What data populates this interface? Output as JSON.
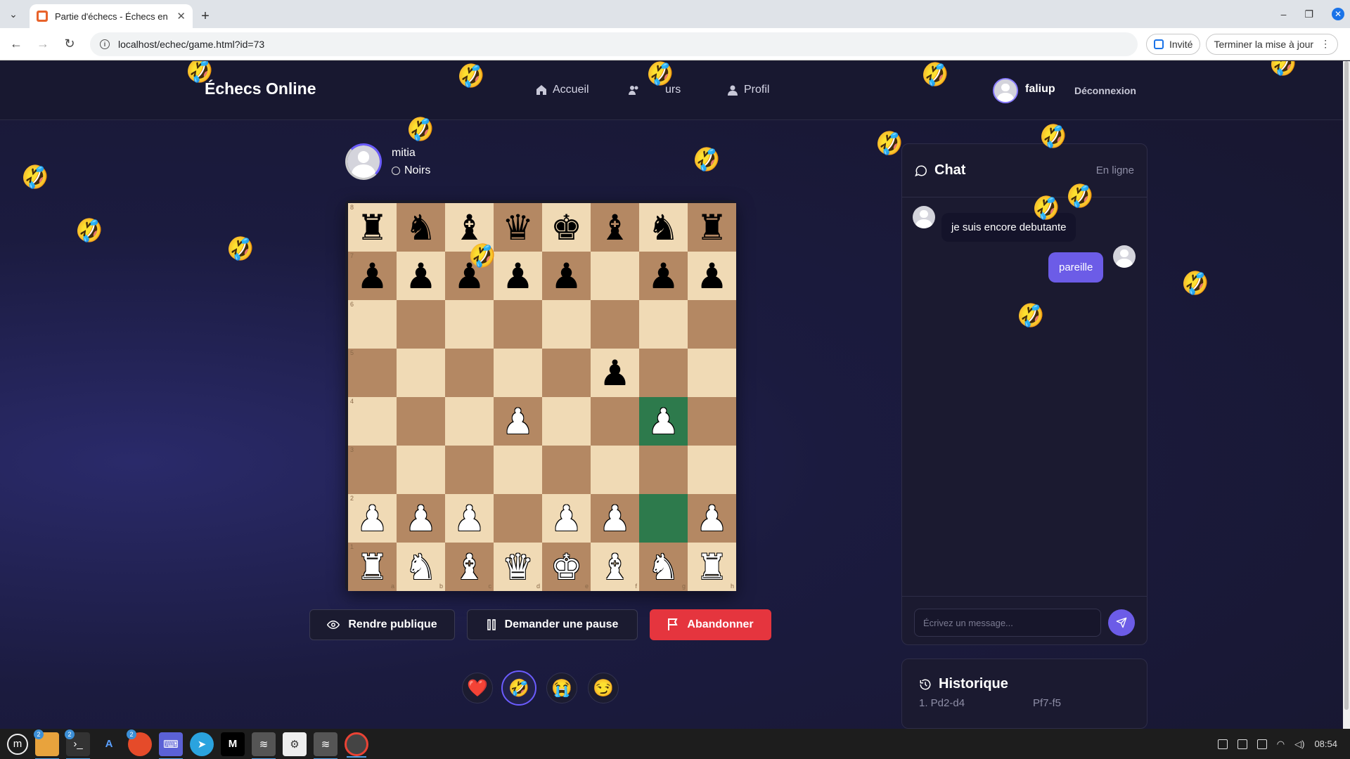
{
  "browser": {
    "tab_title": "Partie d'échecs - Échecs en L",
    "url": "localhost/echec/game.html?id=73",
    "guest_label": "Invité",
    "update_label": "Terminer la mise à jour"
  },
  "site": {
    "logo": "Échecs Online",
    "nav": {
      "home": "Accueil",
      "players": "urs",
      "profile": "Profil"
    },
    "user": {
      "name": "faliup",
      "logout": "Déconnexion"
    }
  },
  "opponent": {
    "name": "mitia",
    "color_label": "Noirs"
  },
  "board": {
    "ranks": [
      "8",
      "7",
      "6",
      "5",
      "4",
      "3",
      "2",
      "1"
    ],
    "files": [
      "a",
      "b",
      "c",
      "d",
      "e",
      "f",
      "g",
      "h"
    ],
    "rows": [
      [
        "bR",
        "bN",
        "bB",
        "bQ",
        "bK",
        "bB",
        "bN",
        "bR"
      ],
      [
        "bP",
        "bP",
        "bP",
        "bP",
        "bP",
        "",
        "bP",
        "bP"
      ],
      [
        "",
        "",
        "",
        "",
        "",
        "",
        "",
        ""
      ],
      [
        "",
        "",
        "",
        "",
        "",
        "bP",
        "",
        ""
      ],
      [
        "",
        "",
        "",
        "wP",
        "",
        "",
        "wP",
        ""
      ],
      [
        "",
        "",
        "",
        "",
        "",
        "",
        "",
        ""
      ],
      [
        "wP",
        "wP",
        "wP",
        "",
        "wP",
        "wP",
        "",
        "wP"
      ],
      [
        "wR",
        "wN",
        "wB",
        "wQ",
        "wK",
        "wB",
        "wN",
        "wR"
      ]
    ],
    "highlight": [
      [
        4,
        6
      ],
      [
        6,
        6
      ]
    ],
    "colors": {
      "light": "#f0dab5",
      "dark": "#b48863",
      "highlight": "#2d7a4c"
    }
  },
  "actions": {
    "public": "Rendre publique",
    "pause": "Demander une pause",
    "resign": "Abandonner"
  },
  "reactions": [
    "❤️",
    "🤣",
    "😭",
    "😏"
  ],
  "chat": {
    "title": "Chat",
    "status": "En ligne",
    "messages": [
      {
        "text": "je suis encore debutante",
        "from": "opponent"
      },
      {
        "text": "pareille",
        "from": "me"
      }
    ],
    "placeholder": "Écrivez un message..."
  },
  "history": {
    "title": "Historique",
    "moves": [
      "1. Pd2-d4",
      "Pf7-f5"
    ]
  },
  "clock": "08:54",
  "accent": "#6c5ce7",
  "danger": "#e5353e"
}
